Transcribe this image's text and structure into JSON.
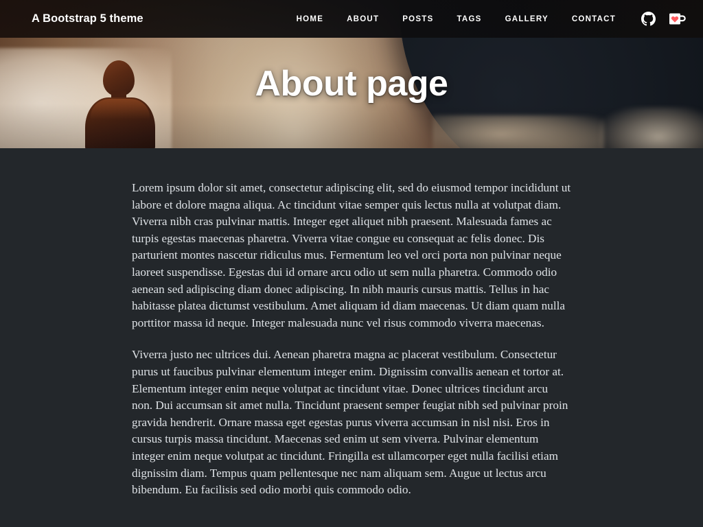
{
  "site": {
    "brand": "A Bootstrap 5 theme"
  },
  "nav": {
    "items": [
      {
        "label": "Home",
        "name": "home"
      },
      {
        "label": "About",
        "name": "about"
      },
      {
        "label": "Posts",
        "name": "posts"
      },
      {
        "label": "Tags",
        "name": "tags"
      },
      {
        "label": "Gallery",
        "name": "gallery"
      },
      {
        "label": "Contact",
        "name": "contact"
      }
    ],
    "icons": [
      {
        "icon": "github-icon",
        "title": "GitHub"
      },
      {
        "icon": "coffee-cup-heart-icon",
        "title": "Buy me a coffee"
      }
    ]
  },
  "hero": {
    "title": "About page",
    "image_alt": "Silhouette of a man in a suit facing a sunset sky with clouds and a large dark planet"
  },
  "article": {
    "paragraphs": [
      "Lorem ipsum dolor sit amet, consectetur adipiscing elit, sed do eiusmod tempor incididunt ut labore et dolore magna aliqua. Ac tincidunt vitae semper quis lectus nulla at volutpat diam. Viverra nibh cras pulvinar mattis. Integer eget aliquet nibh praesent. Malesuada fames ac turpis egestas maecenas pharetra. Viverra vitae congue eu consequat ac felis donec. Dis parturient montes nascetur ridiculus mus. Fermentum leo vel orci porta non pulvinar neque laoreet suspendisse. Egestas dui id ornare arcu odio ut sem nulla pharetra. Commodo odio aenean sed adipiscing diam donec adipiscing. In nibh mauris cursus mattis. Tellus in hac habitasse platea dictumst vestibulum. Amet aliquam id diam maecenas. Ut diam quam nulla porttitor massa id neque. Integer malesuada nunc vel risus commodo viverra maecenas.",
      "Viverra justo nec ultrices dui. Aenean pharetra magna ac placerat vestibulum. Consectetur purus ut faucibus pulvinar elementum integer enim. Dignissim convallis aenean et tortor at. Elementum integer enim neque volutpat ac tincidunt vitae. Donec ultrices tincidunt arcu non. Dui accumsan sit amet nulla. Tincidunt praesent semper feugiat nibh sed pulvinar proin gravida hendrerit. Ornare massa eget egestas purus viverra accumsan in nisl nisi. Eros in cursus turpis massa tincidunt. Maecenas sed enim ut sem viverra. Pulvinar elementum integer enim neque volutpat ac tincidunt. Fringilla est ullamcorper eget nulla facilisi etiam dignissim diam. Tempus quam pellentesque nec nam aliquam sem. Augue ut lectus arcu bibendum. Eu facilisis sed odio morbi quis commodo odio."
    ]
  },
  "colors": {
    "body_background": "#23272b",
    "navbar_background": "#121214",
    "text": "#dee2e6",
    "title": "#ffffff",
    "accent_warm": "#8d6a4c",
    "heart": "#ff5a5f"
  }
}
